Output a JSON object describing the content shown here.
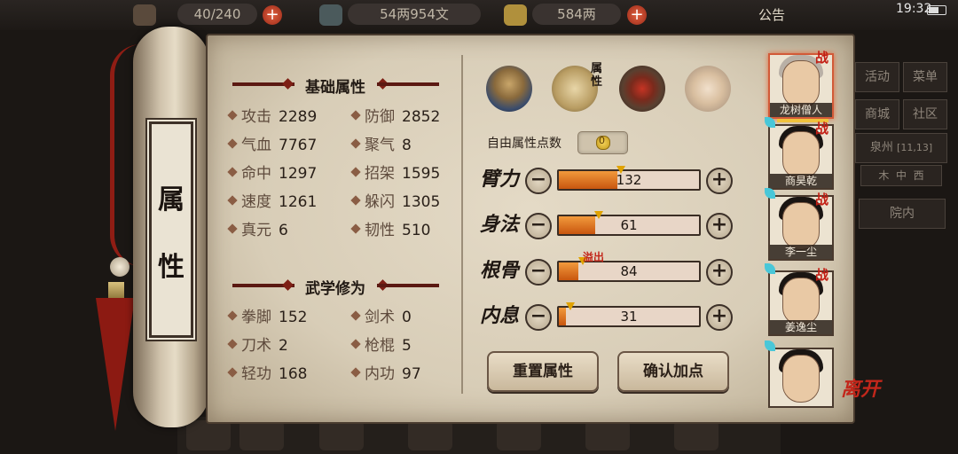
{
  "topbar": {
    "stamina": "40/240",
    "copper": "54两954文",
    "silver": "584两",
    "notice": "公告",
    "clock": "19:32"
  },
  "right_menu": {
    "activity": "活动",
    "menu": "菜单",
    "shop": "商城",
    "community": "社区",
    "location": "泉州",
    "coords": "[11,13]",
    "dir_a": "木",
    "dir_b": "中",
    "dir_c": "西",
    "courtyard": "院内"
  },
  "scroll": {
    "title_1": "属",
    "title_2": "性"
  },
  "base_attributes": {
    "title": "基础属性",
    "stats": [
      {
        "label": "攻击",
        "value": "2289"
      },
      {
        "label": "防御",
        "value": "2852"
      },
      {
        "label": "气血",
        "value": "7767"
      },
      {
        "label": "聚气",
        "value": "8"
      },
      {
        "label": "命中",
        "value": "1297"
      },
      {
        "label": "招架",
        "value": "1595"
      },
      {
        "label": "速度",
        "value": "1261"
      },
      {
        "label": "躲闪",
        "value": "1305"
      },
      {
        "label": "真元",
        "value": "6"
      },
      {
        "label": "韧性",
        "value": "510"
      }
    ]
  },
  "martial_arts": {
    "title": "武学修为",
    "stats": [
      {
        "label": "拳脚",
        "value": "152"
      },
      {
        "label": "剑术",
        "value": "0"
      },
      {
        "label": "刀术",
        "value": "2"
      },
      {
        "label": "枪棍",
        "value": "5"
      },
      {
        "label": "轻功",
        "value": "168"
      },
      {
        "label": "内功",
        "value": "97"
      }
    ]
  },
  "tabs": {
    "active_label": "属性",
    "icons": [
      "character-hat-icon",
      "attribute-scroll-icon",
      "bagua-icon",
      "martial-pose-icon"
    ]
  },
  "free_points": {
    "label": "自由属性点数",
    "value": "0"
  },
  "attributes": [
    {
      "name": "臂力",
      "value": "132",
      "fill": 0.42
    },
    {
      "name": "身法",
      "value": "61",
      "fill": 0.26
    },
    {
      "name": "根骨",
      "value": "84",
      "fill": 0.14
    },
    {
      "name": "内息",
      "value": "31",
      "fill": 0.05
    }
  ],
  "overflow_label": "溢出",
  "buttons": {
    "reset": "重置属性",
    "confirm": "确认加点"
  },
  "party": [
    {
      "name": "龙树僧人",
      "battle_tag": "战"
    },
    {
      "name": "商昊乾",
      "battle_tag": "战"
    },
    {
      "name": "李一尘",
      "battle_tag": "战"
    },
    {
      "name": "姜逸尘",
      "battle_tag": "战"
    },
    {
      "name": "",
      "battle_tag": ""
    }
  ],
  "leave_label": "离开",
  "colors": {
    "accent_red": "#c2271b",
    "bar_fill": "#e07a25",
    "paper": "#ddd2bc"
  }
}
